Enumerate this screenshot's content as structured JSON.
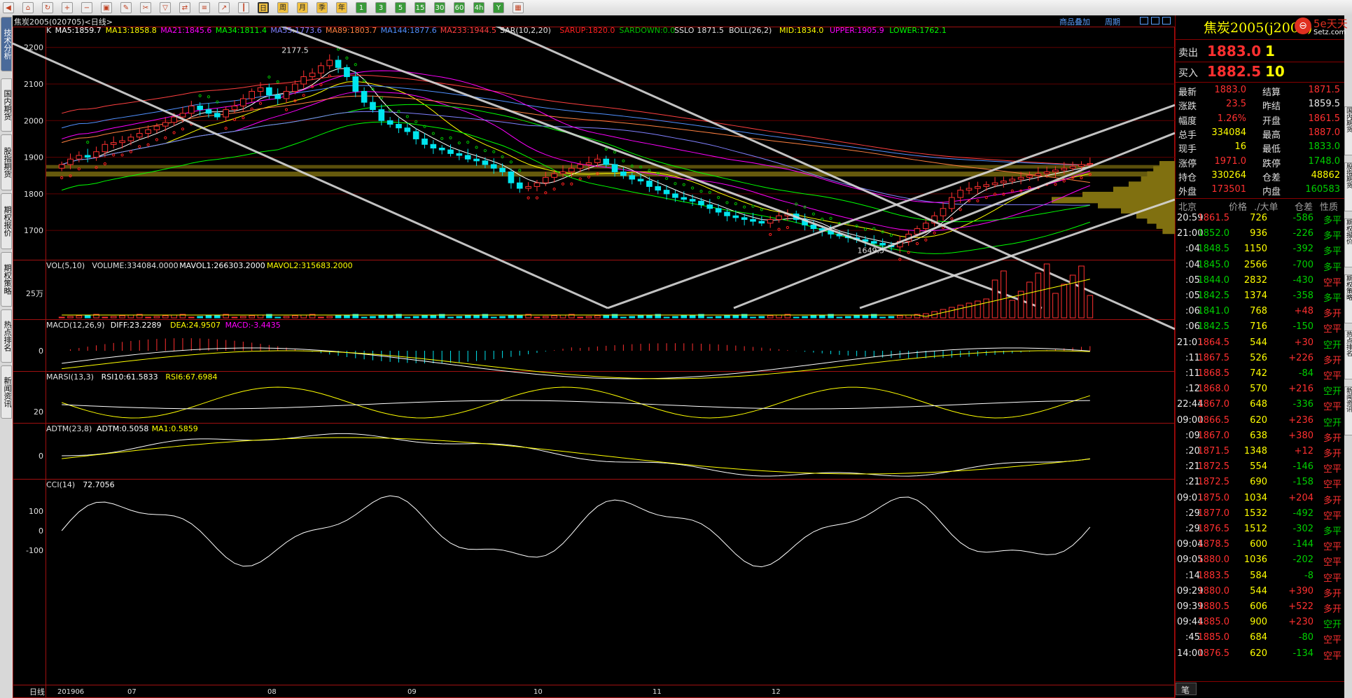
{
  "toolbar": {
    "icons": [
      "back-icon",
      "home-icon",
      "refresh-icon",
      "zoom-in-icon",
      "zoom-out-icon",
      "window-icon",
      "pen-icon",
      "tool-icon",
      "filter-icon",
      "compare-icon",
      "list-icon",
      "trend-icon",
      "kline-icon",
      "day-icon",
      "week-icon",
      "month-icon",
      "season-icon",
      "year-icon",
      "min1-icon",
      "min3-icon",
      "min5-icon",
      "min15-icon",
      "min30-icon",
      "min60-icon",
      "min240-icon",
      "multi-day-icon",
      "calculator-icon"
    ],
    "period_buttons": [
      "日",
      "周",
      "月",
      "季",
      "年",
      "1",
      "3",
      "5",
      "15",
      "30",
      "60",
      "4h",
      "Y"
    ]
  },
  "left_nav": [
    "技术分析",
    "国内期货",
    "股指期货",
    "期权报价",
    "期权策略",
    "热点排名",
    "新闻资讯"
  ],
  "right_nav": [
    "国内期货",
    "股指期货",
    "期权报价",
    "期权策略",
    "热点排名",
    "新闻资讯"
  ],
  "title_bar": {
    "symbol": "焦炭2005(020705)<日线>",
    "overlay": "商品叠加",
    "period": "周期"
  },
  "logo": {
    "text": "5e天天",
    "sub": "Setz.com"
  },
  "quote": {
    "name": "焦炭2005(j2005)",
    "sell_label": "卖出",
    "sell_price": "1883.0",
    "sell_vol": "1",
    "buy_label": "买入",
    "buy_price": "1882.5",
    "buy_vol": "10",
    "stats": [
      {
        "l1": "最新",
        "v1": "1883.0",
        "c1": "red",
        "l2": "结算",
        "v2": "1871.5",
        "c2": "red"
      },
      {
        "l1": "涨跌",
        "v1": "23.5",
        "c1": "red",
        "l2": "昨结",
        "v2": "1859.5",
        "c2": "white"
      },
      {
        "l1": "幅度",
        "v1": "1.26%",
        "c1": "red",
        "l2": "开盘",
        "v2": "1861.5",
        "c2": "red"
      },
      {
        "l1": "总手",
        "v1": "334084",
        "c1": "yellow",
        "l2": "最高",
        "v2": "1887.0",
        "c2": "red"
      },
      {
        "l1": "现手",
        "v1": "16",
        "c1": "yellow",
        "l2": "最低",
        "v2": "1833.0",
        "c2": "green"
      },
      {
        "l1": "涨停",
        "v1": "1971.0",
        "c1": "red",
        "l2": "跌停",
        "v2": "1748.0",
        "c2": "green"
      },
      {
        "l1": "持仓",
        "v1": "330264",
        "c1": "yellow",
        "l2": "仓差",
        "v2": "48862",
        "c2": "yellow"
      },
      {
        "l1": "外盘",
        "v1": "173501",
        "c1": "red",
        "l2": "内盘",
        "v2": "160583",
        "c2": "green"
      }
    ],
    "tick_header": [
      "北京",
      "价格",
      "./大单",
      "仓差",
      "性质"
    ],
    "ticks": [
      {
        "time": "20:59",
        "price": "1861.5",
        "pc": "red",
        "vol": "726",
        "diff": "-586",
        "dc": "green",
        "nature": "多平",
        "nc": "green"
      },
      {
        "time": "21:00",
        "price": "1852.0",
        "pc": "green",
        "vol": "936",
        "diff": "-226",
        "dc": "green",
        "nature": "多平",
        "nc": "green"
      },
      {
        "time": ":04",
        "price": "1848.5",
        "pc": "green",
        "vol": "1150",
        "diff": "-392",
        "dc": "green",
        "nature": "多平",
        "nc": "green"
      },
      {
        "time": ":04",
        "price": "1845.0",
        "pc": "green",
        "vol": "2566",
        "diff": "-700",
        "dc": "green",
        "nature": "多平",
        "nc": "green"
      },
      {
        "time": ":05",
        "price": "1844.0",
        "pc": "green",
        "vol": "2832",
        "diff": "-430",
        "dc": "green",
        "nature": "空平",
        "nc": "red"
      },
      {
        "time": ":05",
        "price": "1842.5",
        "pc": "green",
        "vol": "1374",
        "diff": "-358",
        "dc": "green",
        "nature": "多平",
        "nc": "green"
      },
      {
        "time": ":06",
        "price": "1841.0",
        "pc": "green",
        "vol": "768",
        "diff": "+48",
        "dc": "red",
        "nature": "多开",
        "nc": "red"
      },
      {
        "time": ":06",
        "price": "1842.5",
        "pc": "green",
        "vol": "716",
        "diff": "-150",
        "dc": "green",
        "nature": "空平",
        "nc": "red"
      },
      {
        "time": "21:01",
        "price": "1864.5",
        "pc": "red",
        "vol": "544",
        "diff": "+30",
        "dc": "red",
        "nature": "空开",
        "nc": "green"
      },
      {
        "time": ":11",
        "price": "1867.5",
        "pc": "red",
        "vol": "526",
        "diff": "+226",
        "dc": "red",
        "nature": "多开",
        "nc": "red"
      },
      {
        "time": ":11",
        "price": "1868.5",
        "pc": "red",
        "vol": "742",
        "diff": "-84",
        "dc": "green",
        "nature": "空平",
        "nc": "red"
      },
      {
        "time": ":12",
        "price": "1868.0",
        "pc": "red",
        "vol": "570",
        "diff": "+216",
        "dc": "red",
        "nature": "空开",
        "nc": "green"
      },
      {
        "time": "22:44",
        "price": "1867.0",
        "pc": "red",
        "vol": "648",
        "diff": "-336",
        "dc": "green",
        "nature": "空平",
        "nc": "red"
      },
      {
        "time": "09:00",
        "price": "1866.5",
        "pc": "red",
        "vol": "620",
        "diff": "+236",
        "dc": "red",
        "nature": "空开",
        "nc": "green"
      },
      {
        "time": ":09",
        "price": "1867.0",
        "pc": "red",
        "vol": "638",
        "diff": "+380",
        "dc": "red",
        "nature": "多开",
        "nc": "red"
      },
      {
        "time": ":20",
        "price": "1871.5",
        "pc": "red",
        "vol": "1348",
        "diff": "+12",
        "dc": "red",
        "nature": "多开",
        "nc": "red"
      },
      {
        "time": ":21",
        "price": "1872.5",
        "pc": "red",
        "vol": "554",
        "diff": "-146",
        "dc": "green",
        "nature": "空平",
        "nc": "red"
      },
      {
        "time": ":21",
        "price": "1872.5",
        "pc": "red",
        "vol": "690",
        "diff": "-158",
        "dc": "green",
        "nature": "空平",
        "nc": "red"
      },
      {
        "time": "09:01",
        "price": "1875.0",
        "pc": "red",
        "vol": "1034",
        "diff": "+204",
        "dc": "red",
        "nature": "多开",
        "nc": "red"
      },
      {
        "time": ":29",
        "price": "1877.0",
        "pc": "red",
        "vol": "1532",
        "diff": "-492",
        "dc": "green",
        "nature": "空平",
        "nc": "red"
      },
      {
        "time": ":29",
        "price": "1876.5",
        "pc": "red",
        "vol": "1512",
        "diff": "-302",
        "dc": "green",
        "nature": "多平",
        "nc": "green"
      },
      {
        "time": "09:04",
        "price": "1878.5",
        "pc": "red",
        "vol": "600",
        "diff": "-144",
        "dc": "green",
        "nature": "空平",
        "nc": "red"
      },
      {
        "time": "09:05",
        "price": "1880.0",
        "pc": "red",
        "vol": "1036",
        "diff": "-202",
        "dc": "green",
        "nature": "空平",
        "nc": "red"
      },
      {
        "time": ":14",
        "price": "1883.5",
        "pc": "red",
        "vol": "584",
        "diff": "-8",
        "dc": "green",
        "nature": "空平",
        "nc": "red"
      },
      {
        "time": "09:29",
        "price": "1880.0",
        "pc": "red",
        "vol": "544",
        "diff": "+390",
        "dc": "red",
        "nature": "多开",
        "nc": "red"
      },
      {
        "time": "09:39",
        "price": "1880.5",
        "pc": "red",
        "vol": "606",
        "diff": "+522",
        "dc": "red",
        "nature": "多开",
        "nc": "red"
      },
      {
        "time": "09:44",
        "price": "1885.0",
        "pc": "red",
        "vol": "900",
        "diff": "+230",
        "dc": "red",
        "nature": "空开",
        "nc": "green"
      },
      {
        "time": ":45",
        "price": "1885.0",
        "pc": "red",
        "vol": "684",
        "diff": "-80",
        "dc": "green",
        "nature": "空平",
        "nc": "red"
      },
      {
        "time": "14:00",
        "price": "1876.5",
        "pc": "red",
        "vol": "620",
        "diff": "-134",
        "dc": "green",
        "nature": "空平",
        "nc": "red"
      }
    ],
    "footer": "笔"
  },
  "chart_data": {
    "type": "candlestick",
    "main_legend": [
      {
        "t": "K",
        "c": "#e0e0e0"
      },
      {
        "t": "MA5:1859.7",
        "c": "#ffffff"
      },
      {
        "t": "MA13:1858.8",
        "c": "#ffff00"
      },
      {
        "t": "MA21:1845.6",
        "c": "#ff00ff"
      },
      {
        "t": "MA34:1811.4",
        "c": "#00ff00"
      },
      {
        "t": "MA55:1773.6",
        "c": "#8080ff"
      },
      {
        "t": "MA89:1803.7",
        "c": "#ff8040"
      },
      {
        "t": "MA144:1877.6",
        "c": "#5090ff"
      },
      {
        "t": "MA233:1944.5",
        "c": "#ff4040"
      },
      {
        "t": "SAR(10,2,20)",
        "c": "#e0e0e0"
      },
      {
        "t": "SARUP:1820.0",
        "c": "#ff2020"
      },
      {
        "t": "SARDOWN:0.0",
        "c": "#00c000"
      },
      {
        "t": "SSLO",
        "c": "#e0e0e0"
      },
      {
        "t": "1871.5",
        "c": "#e0e0e0"
      },
      {
        "t": "BOLL(26,2)",
        "c": "#e0e0e0"
      },
      {
        "t": "MID:1834.0",
        "c": "#ffff00"
      },
      {
        "t": "UPPER:1905.9",
        "c": "#ff00ff"
      },
      {
        "t": "LOWER:1762.1",
        "c": "#00ff00"
      }
    ],
    "price_ticks": [
      2200,
      2100,
      2000,
      1900,
      1800,
      1700
    ],
    "ylim": [
      1620,
      2230
    ],
    "max_label": "2177.5",
    "min_label": "1649.5",
    "x_labels": [
      "201906",
      "07",
      "08",
      "09",
      "10",
      "11",
      "12"
    ],
    "period_label": "日线",
    "closes": [
      1880,
      1895,
      1905,
      1900,
      1915,
      1935,
      1940,
      1945,
      1955,
      1965,
      1975,
      1985,
      1995,
      2010,
      2020,
      2040,
      2030,
      2020,
      2010,
      2030,
      2040,
      2060,
      2080,
      2090,
      2070,
      2060,
      2080,
      2100,
      2120,
      2130,
      2150,
      2165,
      2145,
      2120,
      2080,
      2050,
      2030,
      2000,
      1990,
      1980,
      1970,
      1950,
      1935,
      1925,
      1920,
      1910,
      1905,
      1895,
      1890,
      1880,
      1870,
      1860,
      1830,
      1815,
      1820,
      1830,
      1845,
      1855,
      1860,
      1870,
      1880,
      1885,
      1895,
      1880,
      1860,
      1850,
      1840,
      1835,
      1820,
      1810,
      1800,
      1790,
      1785,
      1780,
      1770,
      1760,
      1750,
      1740,
      1735,
      1730,
      1725,
      1720,
      1730,
      1740,
      1745,
      1730,
      1715,
      1705,
      1700,
      1690,
      1685,
      1680,
      1675,
      1670,
      1665,
      1660,
      1655,
      1670,
      1690,
      1705,
      1720,
      1740,
      1760,
      1790,
      1810,
      1815,
      1820,
      1825,
      1830,
      1835,
      1840,
      1845,
      1850,
      1855,
      1860,
      1865,
      1870,
      1875,
      1880,
      1883
    ],
    "volume_panel": {
      "title": "VOL(5,10)",
      "legend": [
        {
          "t": "VOLUME:334084.0000",
          "c": "#e0e0e0"
        },
        {
          "t": "MAVOL1:266303.2000",
          "c": "#ffffff"
        },
        {
          "t": "MAVOL2:315683.2000",
          "c": "#ffff00"
        }
      ],
      "tick": "25万"
    },
    "macd_panel": {
      "title": "MACD(12,26,9)",
      "legend": [
        {
          "t": "DIFF:23.2289",
          "c": "#ffffff"
        },
        {
          "t": "DEA:24.9507",
          "c": "#ffff00"
        },
        {
          "t": "MACD:-3.4435",
          "c": "#ff00ff"
        }
      ],
      "tick": "0"
    },
    "rsi_panel": {
      "title": "MARSI(13,3)",
      "legend": [
        {
          "t": "RSI10:61.5833",
          "c": "#ffffff"
        },
        {
          "t": "RSI6:67.6984",
          "c": "#ffff00"
        }
      ],
      "tick": "20"
    },
    "adtm_panel": {
      "title": "ADTM(23,8)",
      "legend": [
        {
          "t": "ADTM:0.5058",
          "c": "#ffffff"
        },
        {
          "t": "MA1:0.5859",
          "c": "#ffff00"
        }
      ],
      "tick": "0"
    },
    "cci_panel": {
      "title": "CCI(14)",
      "legend": [
        {
          "t": "72.7056",
          "c": "#ffffff"
        }
      ],
      "ticks": [
        "100",
        "0",
        "-100"
      ]
    }
  }
}
